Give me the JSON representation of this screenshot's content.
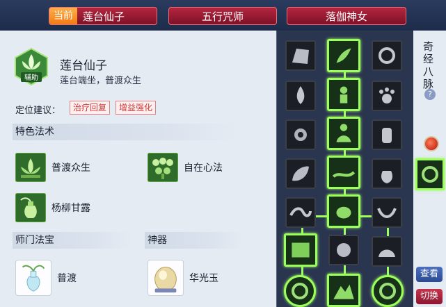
{
  "tabs": {
    "current_prefix": "当前",
    "current_name": "莲台仙子",
    "tab2": "五行咒师",
    "tab3": "落伽神女"
  },
  "school": {
    "title": "莲台仙子",
    "description": "莲台端坐，普渡众生",
    "role_badge": "辅助",
    "icon": "lotus-icon"
  },
  "positioning": {
    "label": "定位建议：",
    "tags": [
      "治疗回复",
      "增益强化"
    ]
  },
  "special_skills": {
    "header": "特色法术",
    "items": [
      {
        "name": "普渡众生",
        "icon": "lotus-skill-icon"
      },
      {
        "name": "自在心法",
        "icon": "hearts-skill-icon"
      },
      {
        "name": "杨柳甘露",
        "icon": "vase-willow-icon"
      }
    ]
  },
  "treasure": {
    "header": "师门法宝",
    "item": {
      "name": "普渡",
      "icon": "jade-vase-icon"
    }
  },
  "artifact": {
    "header": "神器",
    "item": {
      "name": "华光玉",
      "icon": "jade-stone-icon"
    }
  },
  "side": {
    "meridian_label": "奇经八脉",
    "help": "?",
    "view_button": "查看",
    "switch_button": "切换"
  },
  "colors": {
    "accent_red": "#b3263e",
    "accent_orange": "#f27a12",
    "active_green": "#9dff5c",
    "tag_red": "#d23a3a"
  }
}
